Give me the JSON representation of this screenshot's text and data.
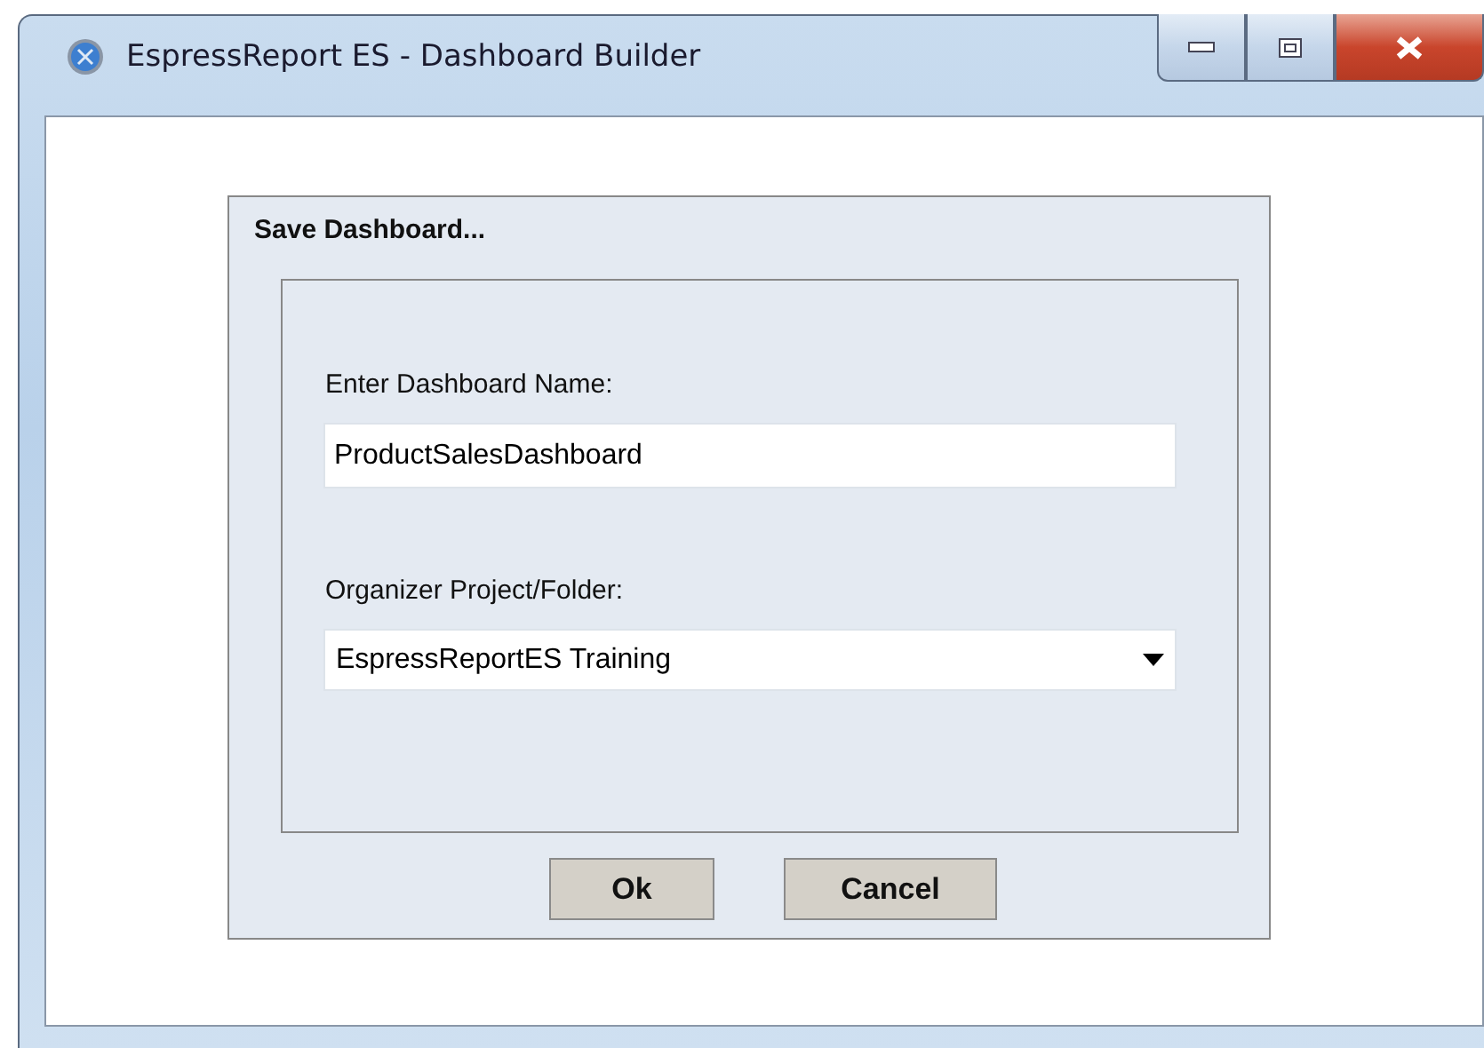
{
  "window": {
    "title": "EspressReport ES - Dashboard Builder"
  },
  "dialog": {
    "title": "Save Dashboard...",
    "name_field": {
      "label": "Enter Dashboard Name:",
      "value": "ProductSalesDashboard"
    },
    "folder_select": {
      "label": "Organizer Project/Folder:",
      "value": "EspressReportES Training"
    },
    "buttons": [
      "Ok",
      "Cancel"
    ]
  }
}
